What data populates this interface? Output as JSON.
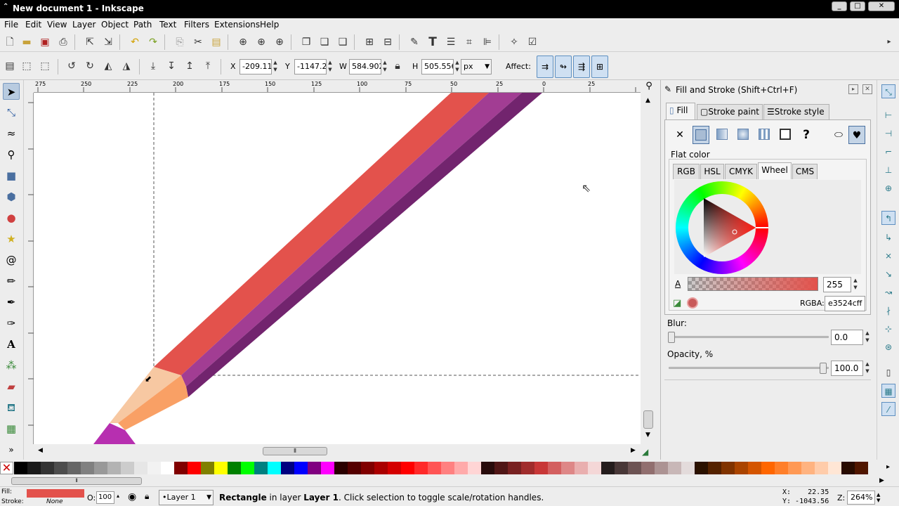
{
  "window": {
    "title": "New document 1 - Inkscape",
    "min": "_",
    "max": "□",
    "close": "✕"
  },
  "menu": [
    "File",
    "Edit",
    "View",
    "Layer",
    "Object",
    "Path",
    "Text",
    "Filters",
    "Extensions",
    "Help"
  ],
  "toolctrl": {
    "x_label": "X",
    "x_value": "-209.118",
    "y_label": "Y",
    "y_value": "-1147.26",
    "w_label": "W",
    "w_value": "584.902",
    "h_label": "H",
    "h_value": "505.556",
    "unit": "px",
    "affect_label": "Affect:"
  },
  "ruler_labels": [
    "275",
    "250",
    "225",
    "200",
    "175",
    "150",
    "125",
    "100",
    "75",
    "50",
    "25",
    "0",
    "25"
  ],
  "dialog": {
    "title": "Fill and Stroke (Shift+Ctrl+F)",
    "tabs": [
      "Fill",
      "Stroke paint",
      "Stroke style"
    ],
    "flat_color_label": "Flat color",
    "color_tabs": [
      "RGB",
      "HSL",
      "CMYK",
      "Wheel",
      "CMS"
    ],
    "alpha_label": "A",
    "alpha_value": "255",
    "rgba_label": "RGBA:",
    "rgba_value": "e3524cff",
    "blur_label": "Blur:",
    "blur_value": "0.0",
    "opacity_label": "Opacity, %",
    "opacity_value": "100.0",
    "unset_glyph": "?"
  },
  "status": {
    "fill_label": "Fill:",
    "stroke_label": "Stroke:",
    "stroke_value": "None",
    "fill_color": "#e3524c",
    "opacity_label": "O:",
    "opacity_value": "100",
    "layer": "•Layer 1",
    "message_bold1": "Rectangle",
    "message_mid": " in layer ",
    "message_bold2": "Layer 1",
    "message_end": ". Click selection to toggle scale/rotation handles.",
    "x_coord": "X:    22.35",
    "y_coord": "Y: -1043.56",
    "zoom_label": "Z:",
    "zoom_value": "264%"
  },
  "colors": {
    "pencil_red": "#e3524c",
    "pencil_purple": "#a23d93",
    "pencil_dark": "#72246e",
    "wood_light": "#f7c8a2",
    "wood_orange": "#f9a065",
    "lead": "#b72fb0"
  },
  "palette": [
    "#000000",
    "#1a1a1a",
    "#333333",
    "#4d4d4d",
    "#666666",
    "#808080",
    "#999999",
    "#b3b3b3",
    "#cccccc",
    "#e6e6e6",
    "#f2f2f2",
    "#ffffff",
    "#800000",
    "#ff0000",
    "#808000",
    "#ffff00",
    "#008000",
    "#00ff00",
    "#008080",
    "#00ffff",
    "#000080",
    "#0000ff",
    "#800080",
    "#ff00ff",
    "#2b0000",
    "#550000",
    "#800000",
    "#aa0000",
    "#d40000",
    "#ff0000",
    "#ff2a2a",
    "#ff5555",
    "#ff8080",
    "#ffaaaa",
    "#ffd5d5",
    "#280b0b",
    "#501616",
    "#782121",
    "#a02c2c",
    "#c83737",
    "#d35f5f",
    "#de8787",
    "#e9afaf",
    "#f4d7d7",
    "#241c1c",
    "#483737",
    "#6c5353",
    "#916f6f",
    "#ac9393",
    "#c8b7b7",
    "#e3dbdb",
    "#2b1100",
    "#552200",
    "#803300",
    "#aa4400",
    "#d45500",
    "#ff6600",
    "#ff7f2a",
    "#ff9955",
    "#ffb380",
    "#ffccaa",
    "#ffe6d5",
    "#280b00",
    "#501600"
  ]
}
